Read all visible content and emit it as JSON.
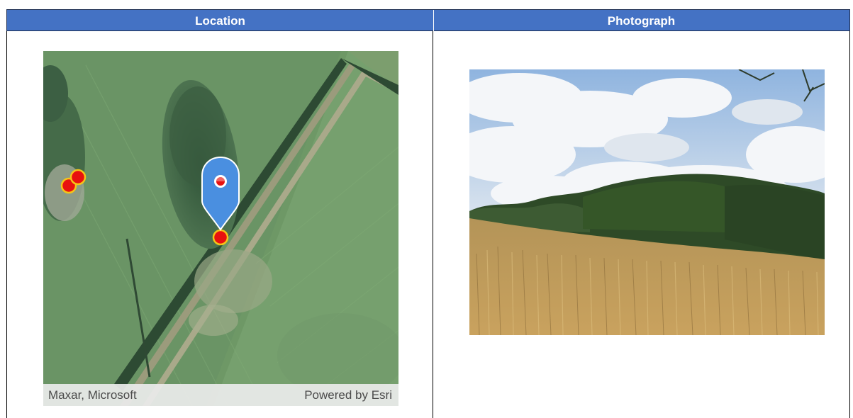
{
  "table": {
    "columns": [
      {
        "header": "Location"
      },
      {
        "header": "Photograph"
      }
    ]
  },
  "map": {
    "attribution_left": "Maxar, Microsoft",
    "attribution_right": "Powered by Esri",
    "marker_color": "#4a8fe0",
    "point_fill": "#e8110f",
    "point_stroke": "#f5c518",
    "imagery": "satellite-farmland"
  },
  "photo": {
    "subject": "wheat-field-hedgerow-sky"
  },
  "colors": {
    "header_bg": "#4472c4",
    "header_text": "#ffffff"
  }
}
